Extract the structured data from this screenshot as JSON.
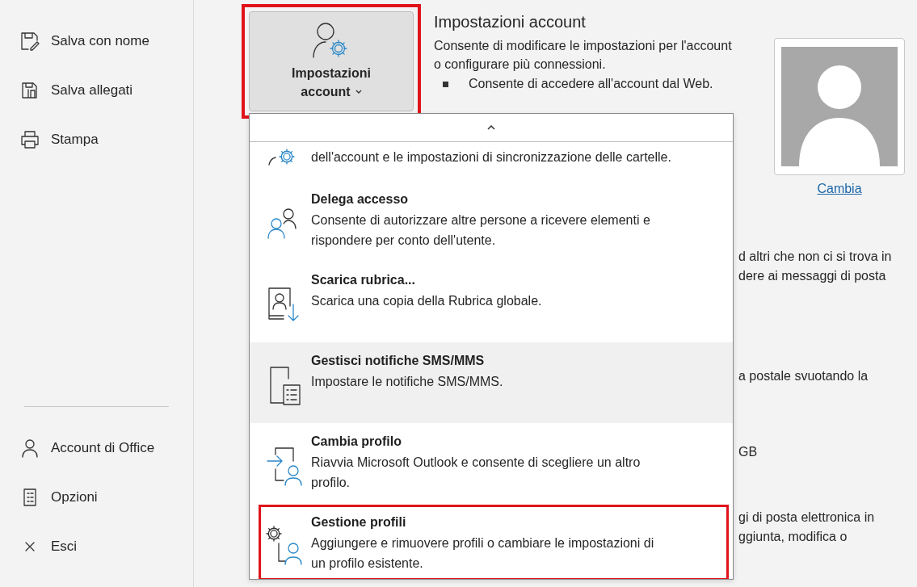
{
  "sidebar": {
    "top_items": [
      {
        "label": "Salva con nome"
      },
      {
        "label": "Salva allegati"
      },
      {
        "label": "Stampa"
      }
    ],
    "bottom_items": [
      {
        "label": "Account di Office"
      },
      {
        "label": "Opzioni"
      },
      {
        "label": "Esci"
      }
    ]
  },
  "account_button": {
    "label": "Impostazioni account",
    "outlined": true
  },
  "section": {
    "title": "Impostazioni account",
    "description": "Consente di modificare le impostazioni per l'account o configurare più connessioni.",
    "bullets": [
      "Consente di accedere all'account dal Web."
    ]
  },
  "photo": {
    "link": "Cambia"
  },
  "background_fragments": [
    [
      "d altri che non ci si trova in",
      "dere ai messaggi di posta"
    ],
    [
      "a postale svuotando la"
    ],
    [
      "GB"
    ],
    [
      "gi di posta elettronica in",
      "ggiunta, modifica o"
    ]
  ],
  "menu": {
    "items": [
      {
        "description": "dell'account e le impostazioni di sincronizzazione delle cartelle.",
        "highlighted": false,
        "outlined": false
      },
      {
        "title": "Delega accesso",
        "description": "Consente di autorizzare altre persone a ricevere elementi e rispondere per conto dell'utente.",
        "highlighted": false,
        "outlined": false
      },
      {
        "title": "Scarica rubrica...",
        "description": "Scarica una copia della Rubrica globale.",
        "highlighted": false,
        "outlined": false
      },
      {
        "title": "Gestisci notifiche SMS/MMS",
        "description": "Impostare le notifiche SMS/MMS.",
        "highlighted": true,
        "outlined": false
      },
      {
        "title": "Cambia profilo",
        "description": "Riavvia Microsoft Outlook e consente di scegliere un altro profilo.",
        "highlighted": false,
        "outlined": false
      },
      {
        "title": "Gestione profili",
        "description": "Aggiungere e rimuovere profili o cambiare le impostazioni di un profilo esistente.",
        "highlighted": false,
        "outlined": true
      }
    ]
  }
}
